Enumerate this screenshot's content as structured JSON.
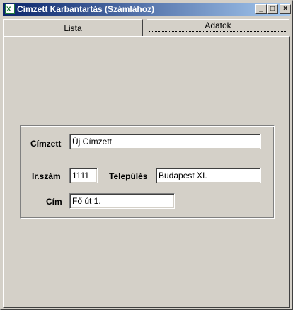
{
  "window": {
    "title": "Címzett Karbantartás (Számlához)",
    "controls": {
      "minimize": "_",
      "maximize": "□",
      "close": "×"
    }
  },
  "tabs": [
    {
      "label": "Lista",
      "selected": true
    },
    {
      "label": "Adatok",
      "selected": false
    }
  ],
  "form": {
    "cimzett_label": "Címzett",
    "cimzett_value": "Új Címzett",
    "irszam_label": "Ir.szám",
    "irszam_value": "1111",
    "telepules_label": "Település",
    "telepules_value": "Budapest XI.",
    "cim_label": "Cím",
    "cim_value": "Fő út 1."
  },
  "icons": {
    "app": "app-icon"
  }
}
